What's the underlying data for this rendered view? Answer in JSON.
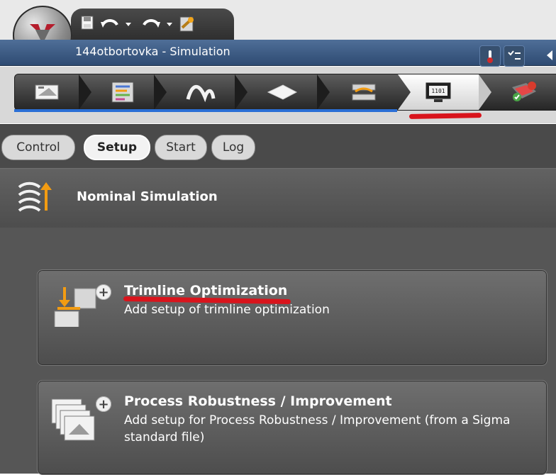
{
  "window": {
    "title": "144otbortovka - Simulation"
  },
  "quick_access": {
    "save_label": "💾",
    "undo_label": "↶",
    "redo_label": "↷",
    "extra_label": "▼"
  },
  "workflow": {
    "steps": [
      {
        "icon": "document-icon"
      },
      {
        "icon": "list-icon"
      },
      {
        "icon": "curve-icon"
      },
      {
        "icon": "sheet-icon"
      },
      {
        "icon": "die-icon"
      },
      {
        "icon": "simulation-monitor-icon",
        "label": "1101",
        "selected": true
      },
      {
        "icon": "result-check-icon"
      }
    ]
  },
  "subtabs": [
    {
      "label": "Control"
    },
    {
      "label": "Setup"
    },
    {
      "label": "Start"
    },
    {
      "label": "Log"
    }
  ],
  "section": {
    "title": "Nominal Simulation"
  },
  "cards": [
    {
      "title": "Trimline Optimization",
      "description": "Add setup of trimline optimization"
    },
    {
      "title": "Process Robustness / Improvement",
      "description": "Add setup for Process Robustness / Improvement (from a Sigma standard file)"
    }
  ],
  "colors": {
    "accent_blue": "#2b6fd5",
    "annotation_red": "#d9141c"
  }
}
